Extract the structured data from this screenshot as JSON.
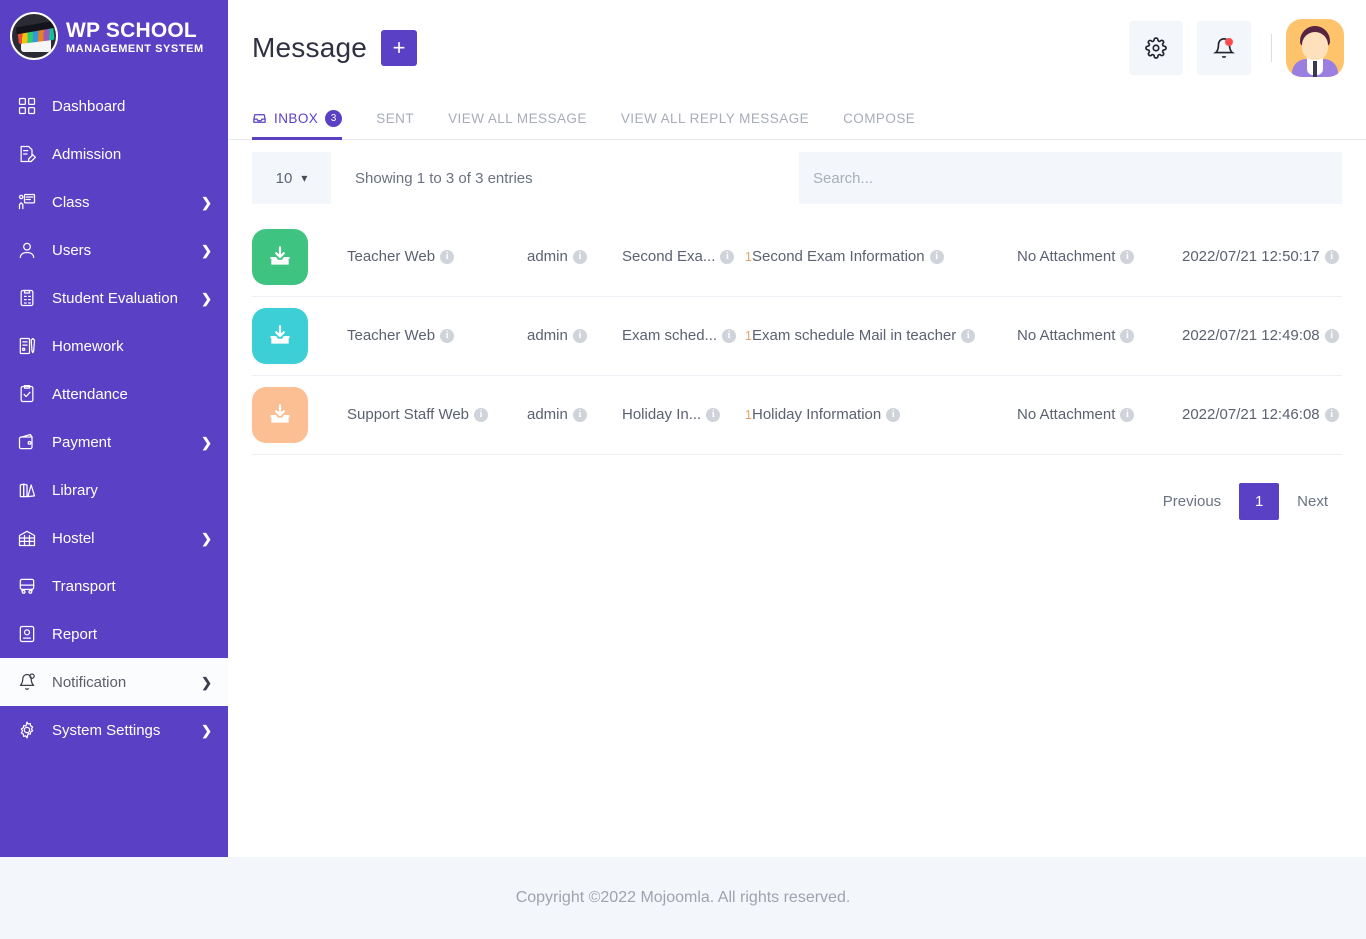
{
  "brand": {
    "title": "WP SCHOOL",
    "subtitle": "MANAGEMENT SYSTEM",
    "logo_icon": "graduation-cap-logo"
  },
  "sidebar": {
    "items": [
      {
        "label": "Dashboard",
        "icon": "grid-icon",
        "caret": "",
        "active": false
      },
      {
        "label": "Admission",
        "icon": "document-pen-icon",
        "caret": "",
        "active": false
      },
      {
        "label": "Class",
        "icon": "presentation-icon",
        "caret": "❯",
        "active": false
      },
      {
        "label": "Users",
        "icon": "user-icon",
        "caret": "❯",
        "active": false
      },
      {
        "label": "Student Evaluation",
        "icon": "clipboard-list-icon",
        "caret": "❯",
        "active": false
      },
      {
        "label": "Homework",
        "icon": "book-pen-icon",
        "caret": "",
        "active": false
      },
      {
        "label": "Attendance",
        "icon": "clipboard-check-icon",
        "caret": "",
        "active": false
      },
      {
        "label": "Payment",
        "icon": "wallet-icon",
        "caret": "❯",
        "active": false
      },
      {
        "label": "Library",
        "icon": "books-icon",
        "caret": "",
        "active": false
      },
      {
        "label": "Hostel",
        "icon": "hostel-icon",
        "caret": "❯",
        "active": false
      },
      {
        "label": "Transport",
        "icon": "bus-icon",
        "caret": "",
        "active": false
      },
      {
        "label": "Report",
        "icon": "report-icon",
        "caret": "",
        "active": false
      },
      {
        "label": "Notification",
        "icon": "bell-icon",
        "caret": "❯",
        "active": true
      },
      {
        "label": "System Settings",
        "icon": "gear-icon",
        "caret": "❯",
        "active": false
      }
    ]
  },
  "header": {
    "title": "Message",
    "add_label": "+",
    "settings_icon": "gear-icon",
    "notification_icon": "bell-icon",
    "avatar_icon": "user-avatar"
  },
  "tabs": [
    {
      "label": "INBOX",
      "badge": "3",
      "icon": "inbox-icon",
      "active": true
    },
    {
      "label": "SENT",
      "badge": "",
      "icon": "",
      "active": false
    },
    {
      "label": "VIEW ALL MESSAGE",
      "badge": "",
      "icon": "",
      "active": false
    },
    {
      "label": "VIEW ALL REPLY MESSAGE",
      "badge": "",
      "icon": "",
      "active": false
    },
    {
      "label": "COMPOSE",
      "badge": "",
      "icon": "",
      "active": false
    }
  ],
  "controls": {
    "page_length": "10",
    "showing_text": "Showing 1 to 3 of 3 entries",
    "search_placeholder": "Search...",
    "search_value": ""
  },
  "table": {
    "rows": [
      {
        "icon_color": "#3fc380",
        "icon": "inbox-download-icon",
        "from": "Teacher Web",
        "user": "admin",
        "subject": "Second Exa...",
        "subject_count": "1",
        "body": "Second Exam Information",
        "attachment": "No Attachment",
        "date": "2022/07/21 12:50:17"
      },
      {
        "icon_color": "#3ccfd6",
        "icon": "inbox-download-icon",
        "from": "Teacher Web",
        "user": "admin",
        "subject": "Exam sched...",
        "subject_count": "1",
        "body": "Exam schedule Mail in teacher",
        "attachment": "No Attachment",
        "date": "2022/07/21 12:49:08"
      },
      {
        "icon_color": "#fbbf93",
        "icon": "inbox-download-icon",
        "from": "Support Staff Web",
        "user": "admin",
        "subject": "Holiday In...",
        "subject_count": "1",
        "body": "Holiday Information",
        "attachment": "No Attachment",
        "date": "2022/07/21 12:46:08"
      }
    ]
  },
  "pagination": {
    "previous": "Previous",
    "pages": [
      "1"
    ],
    "next": "Next",
    "current": "1"
  },
  "footer": {
    "copyright": "Copyright ©2022 Mojoomla. All rights reserved."
  },
  "colors": {
    "brand_purple": "#5940c4",
    "panel_gray": "#f3f6fb",
    "text_muted": "#a7acb9",
    "badge_orange": "#e8a76a"
  }
}
